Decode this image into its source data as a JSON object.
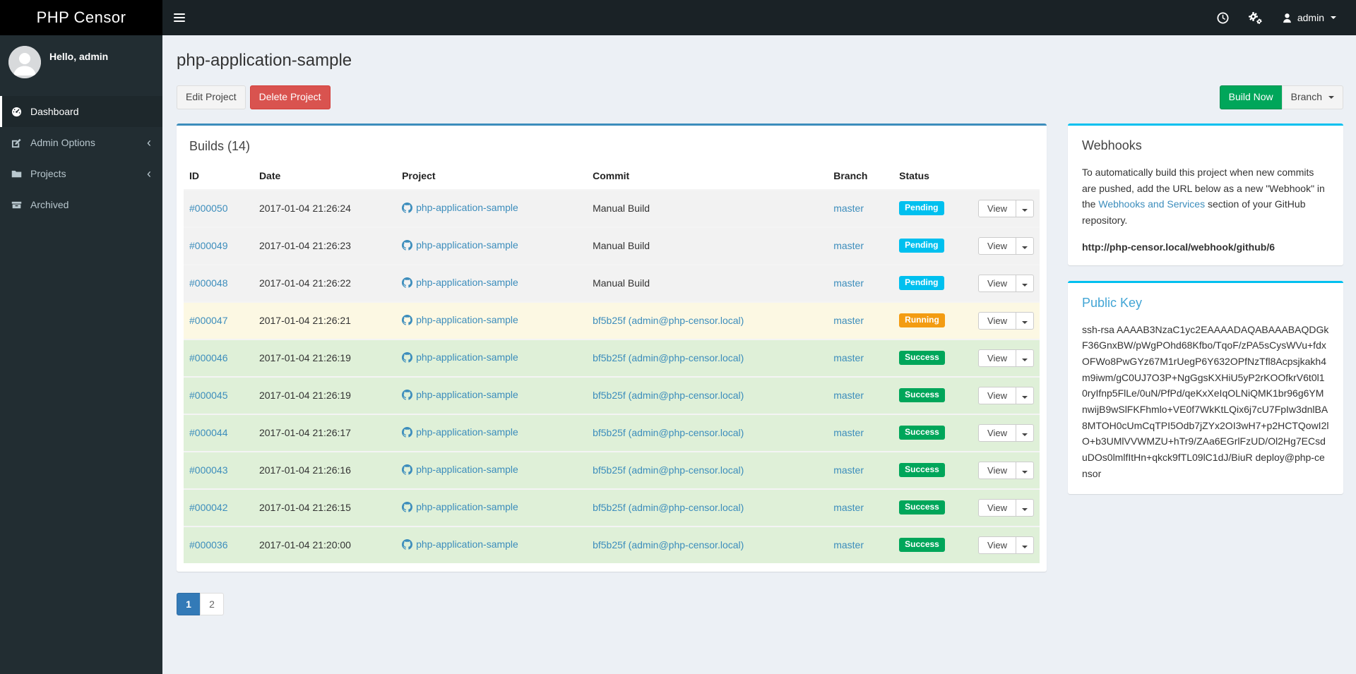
{
  "brand": "PHP Censor",
  "navbar": {
    "username": "admin"
  },
  "sidebar": {
    "greeting": "Hello, admin",
    "items": [
      {
        "label": "Dashboard",
        "icon": "dashboard-icon",
        "active": true,
        "chevron": false
      },
      {
        "label": "Admin Options",
        "icon": "edit-icon",
        "active": false,
        "chevron": true
      },
      {
        "label": "Projects",
        "icon": "folder-icon",
        "active": false,
        "chevron": true
      },
      {
        "label": "Archived",
        "icon": "archive-icon",
        "active": false,
        "chevron": false
      }
    ],
    "chevron_glyph": "‹"
  },
  "page": {
    "title": "php-application-sample",
    "edit_button": "Edit Project",
    "delete_button": "Delete Project",
    "build_now_button": "Build Now",
    "branch_button": "Branch"
  },
  "builds": {
    "panel_title": "Builds (14)",
    "columns": [
      "ID",
      "Date",
      "Project",
      "Commit",
      "Branch",
      "Status",
      ""
    ],
    "view_label": "View",
    "rows": [
      {
        "id": "#000050",
        "date": "2017-01-04 21:26:24",
        "project": "php-application-sample",
        "commit": "Manual Build",
        "commit_is_link": false,
        "branch": "master",
        "status": "Pending"
      },
      {
        "id": "#000049",
        "date": "2017-01-04 21:26:23",
        "project": "php-application-sample",
        "commit": "Manual Build",
        "commit_is_link": false,
        "branch": "master",
        "status": "Pending"
      },
      {
        "id": "#000048",
        "date": "2017-01-04 21:26:22",
        "project": "php-application-sample",
        "commit": "Manual Build",
        "commit_is_link": false,
        "branch": "master",
        "status": "Pending"
      },
      {
        "id": "#000047",
        "date": "2017-01-04 21:26:21",
        "project": "php-application-sample",
        "commit": "bf5b25f (admin@php-censor.local)",
        "commit_is_link": true,
        "branch": "master",
        "status": "Running"
      },
      {
        "id": "#000046",
        "date": "2017-01-04 21:26:19",
        "project": "php-application-sample",
        "commit": "bf5b25f (admin@php-censor.local)",
        "commit_is_link": true,
        "branch": "master",
        "status": "Success"
      },
      {
        "id": "#000045",
        "date": "2017-01-04 21:26:19",
        "project": "php-application-sample",
        "commit": "bf5b25f (admin@php-censor.local)",
        "commit_is_link": true,
        "branch": "master",
        "status": "Success"
      },
      {
        "id": "#000044",
        "date": "2017-01-04 21:26:17",
        "project": "php-application-sample",
        "commit": "bf5b25f (admin@php-censor.local)",
        "commit_is_link": true,
        "branch": "master",
        "status": "Success"
      },
      {
        "id": "#000043",
        "date": "2017-01-04 21:26:16",
        "project": "php-application-sample",
        "commit": "bf5b25f (admin@php-censor.local)",
        "commit_is_link": true,
        "branch": "master",
        "status": "Success"
      },
      {
        "id": "#000042",
        "date": "2017-01-04 21:26:15",
        "project": "php-application-sample",
        "commit": "bf5b25f (admin@php-censor.local)",
        "commit_is_link": true,
        "branch": "master",
        "status": "Success"
      },
      {
        "id": "#000036",
        "date": "2017-01-04 21:20:00",
        "project": "php-application-sample",
        "commit": "bf5b25f (admin@php-censor.local)",
        "commit_is_link": true,
        "branch": "master",
        "status": "Success"
      }
    ]
  },
  "pagination": [
    "1",
    "2"
  ],
  "webhooks": {
    "title": "Webhooks",
    "text_before_link": "To automatically build this project when new commits are pushed, add the URL below as a new \"Webhook\" in the ",
    "link_text": "Webhooks and Services",
    "text_after_link": " section of your GitHub repository.",
    "url": "http://php-censor.local/webhook/github/6"
  },
  "public_key": {
    "title": "Public Key",
    "key": "ssh-rsa AAAAB3NzaC1yc2EAAAADAQABAAABAQDGkF36GnxBW/pWgPOhd68Kfbo/TqoF/zPA5sCysWVu+fdxOFWo8PwGYz67M1rUegP6Y632OPfNzTfl8Acpsjkakh4m9iwm/gC0UJ7O3P+NgGgsKXHiU5yP2rKOOfkrV6t0l10ryIfnp5FlLe/0uN/PfPd/qeKxXeIqOLNiQMK1br96g6YMnwijB9wSlFKFhmlo+VE0f7WkKtLQix6j7cU7FpIw3dnlBA8MTOH0cUmCqTPI5Odb7jZYx2OI3wH7+p2HCTQowI2lO+b3UMlVVWMZU+hTr9/ZAa6EGrlFzUD/Ol2Hg7ECsduDOs0lmlfItHn+qkck9fTL09lC1dJ/BiuR deploy@php-censor"
  },
  "colors": {
    "brand_bar": "#1a2226",
    "sidebar": "#222d32",
    "panel_accent": "#3c8dbc",
    "box_accent": "#00c0ef",
    "link": "#3c8dbc",
    "build_now": "#00a65a",
    "delete": "#d9534f",
    "status_colors": {
      "Pending": "#00c0ef",
      "Running": "#f39c12",
      "Success": "#00a65a"
    },
    "row_colors": {
      "Pending": "#f2f2f2",
      "Running": "#fcf8e3",
      "Success": "#dff0d8"
    }
  }
}
